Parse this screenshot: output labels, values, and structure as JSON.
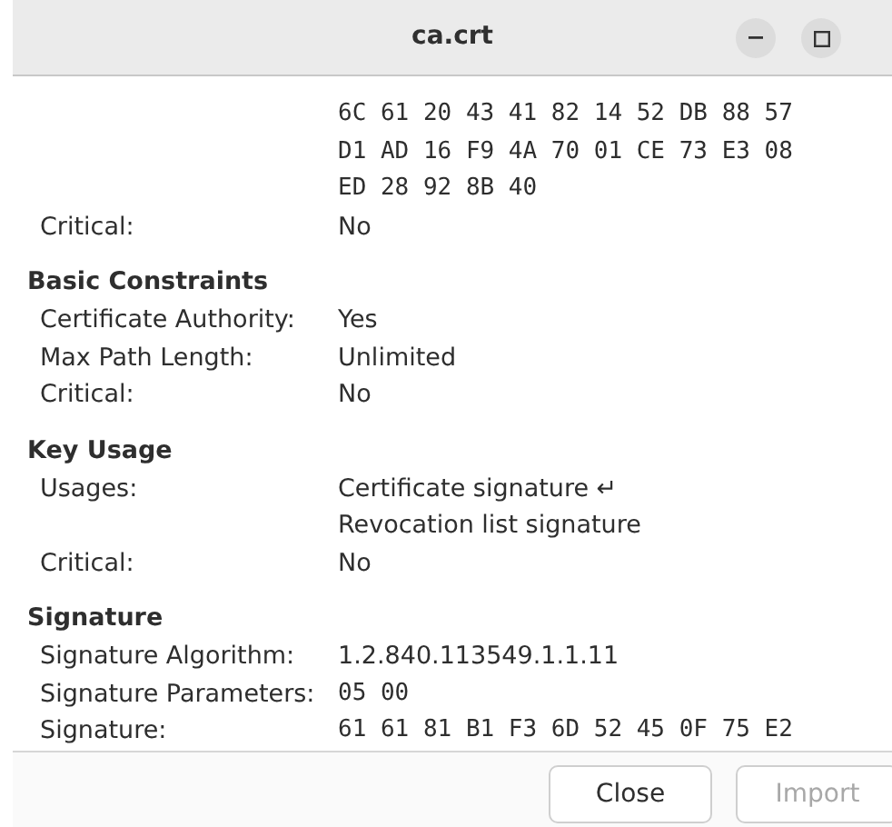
{
  "window": {
    "title": "ca.crt"
  },
  "sections": [
    {
      "rows": [
        {
          "kind": "mono",
          "lines": [
            "6C 61 20 43 41 82 14 52 DB 88 57",
            "D1 AD 16 F9 4A 70 01 CE 73 E3 08",
            "ED 28 92 8B 40"
          ]
        },
        {
          "kind": "text",
          "label": "Critical:",
          "lines": [
            "No"
          ]
        }
      ]
    },
    {
      "title": "Basic Constraints",
      "rows": [
        {
          "kind": "text",
          "label": "Certificate Authority:",
          "lines": [
            "Yes"
          ]
        },
        {
          "kind": "text",
          "label": "Max Path Length:",
          "lines": [
            "Unlimited"
          ]
        },
        {
          "kind": "text",
          "label": "Critical:",
          "lines": [
            "No"
          ]
        }
      ]
    },
    {
      "title": "Key Usage",
      "rows": [
        {
          "kind": "text",
          "label": "Usages:",
          "lines": [
            "Certificate signature ↵",
            "Revocation list signature"
          ]
        },
        {
          "kind": "text",
          "label": "Critical:",
          "lines": [
            "No"
          ]
        }
      ]
    },
    {
      "title": "Signature",
      "rows": [
        {
          "kind": "text",
          "label": "Signature Algorithm:",
          "lines": [
            "1.2.840.113549.1.1.11"
          ]
        },
        {
          "kind": "mono",
          "label": "Signature Parameters:",
          "lines": [
            "05 00"
          ]
        },
        {
          "kind": "mono",
          "label": "Signature:",
          "lines": [
            "61 61 81 B1 F3 6D 52 45 0F 75 E2"
          ]
        }
      ]
    }
  ],
  "buttons": [
    {
      "label": "Close",
      "disabled": false
    },
    {
      "label": "Import",
      "disabled": true
    }
  ]
}
